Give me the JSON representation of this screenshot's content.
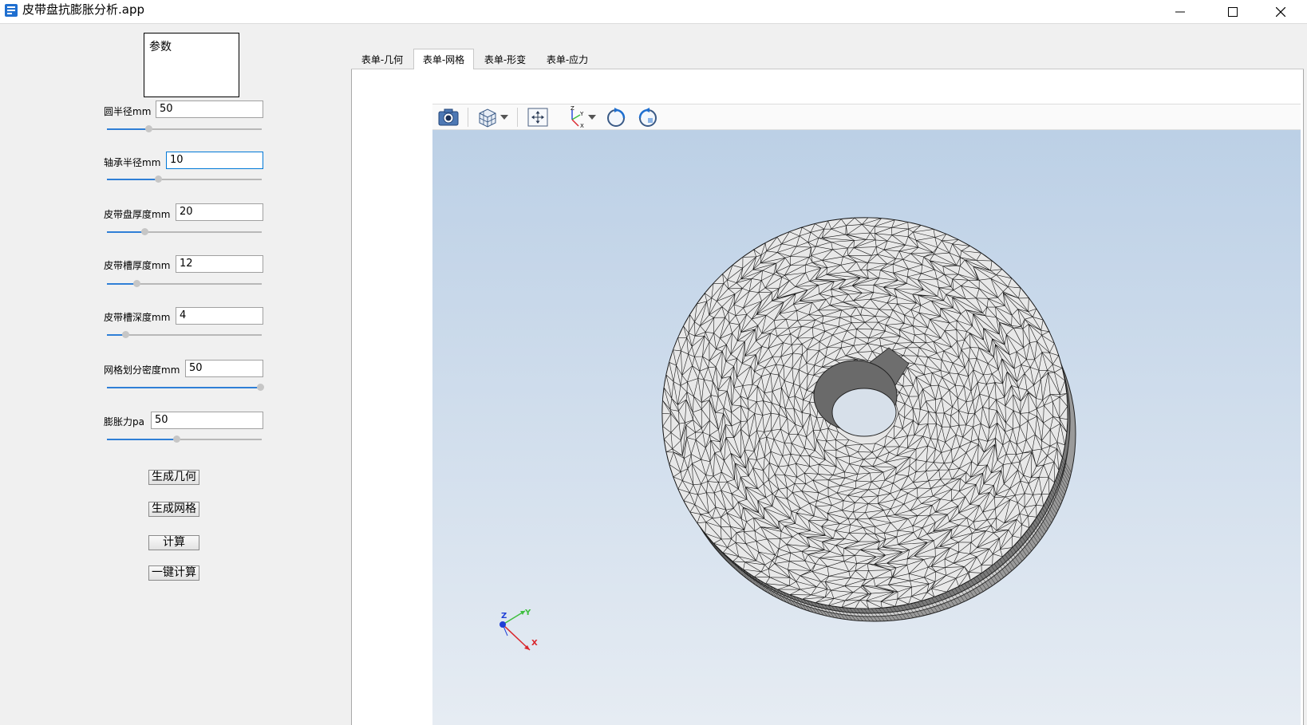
{
  "window": {
    "title": "皮带盘抗膨胀分析.app"
  },
  "params": {
    "box_label": "参数",
    "fields": [
      {
        "label": "圆半径mm",
        "value": "50",
        "slider_fraction": 0.27
      },
      {
        "label": "轴承半径mm",
        "value": "10",
        "slider_fraction": 0.33
      },
      {
        "label": "皮带盘厚度mm",
        "value": "20",
        "slider_fraction": 0.24
      },
      {
        "label": "皮带槽厚度mm",
        "value": "12",
        "slider_fraction": 0.19
      },
      {
        "label": "皮带槽深度mm",
        "value": "4",
        "slider_fraction": 0.12
      },
      {
        "label": "网格划分密度mm",
        "value": "50",
        "slider_fraction": 0.99
      },
      {
        "label": "膨胀力pa",
        "value": "50",
        "slider_fraction": 0.45
      }
    ]
  },
  "actions": {
    "generate_geometry": "生成几何",
    "generate_mesh": "生成网格",
    "compute": "计算",
    "one_click_compute": "一键计算"
  },
  "tabs": [
    {
      "label": "表单-几何",
      "active": false
    },
    {
      "label": "表单-网格",
      "active": true
    },
    {
      "label": "表单-形变",
      "active": false
    },
    {
      "label": "表单-应力",
      "active": false
    }
  ],
  "toolbar": {
    "icons": [
      "camera-icon",
      "cube-view-icon",
      "chevron-down-icon",
      "zoom-extents-icon",
      "axis-orientation-icon",
      "chevron-down-icon",
      "rotate-cw-icon",
      "rotate-ccw-icon"
    ]
  },
  "axes": {
    "x": "X",
    "y": "Y",
    "z": "Z"
  },
  "colors": {
    "accent": "#2f7fd6",
    "viewport_top": "#bcd0e6",
    "viewport_bottom": "#e6ecf3",
    "mesh_face": "#e6e6e6",
    "axis_x": "#d9262c",
    "axis_y": "#3fbf3f",
    "axis_z": "#1f3fd6"
  }
}
